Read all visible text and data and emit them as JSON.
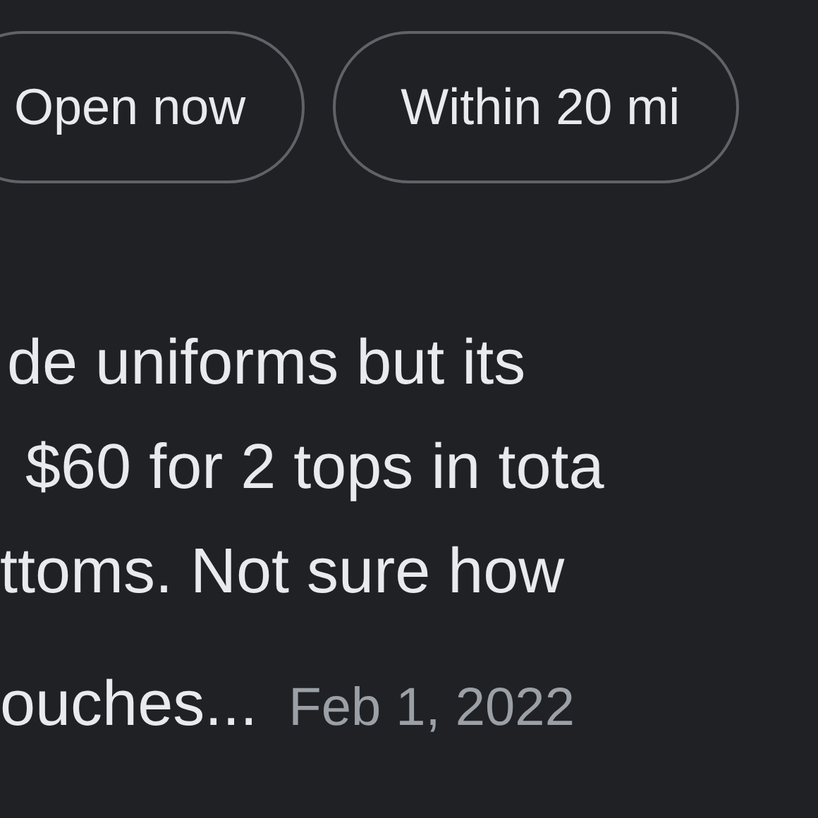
{
  "filter_chips": [
    {
      "label": "Open now"
    },
    {
      "label": "Within 20 mi"
    }
  ],
  "review": {
    "text_lines": [
      "de uniforms but its",
      "$60 for 2 tops in tota",
      "ttoms. Not sure how",
      "ouches..."
    ],
    "date": "Feb 1, 2022"
  }
}
